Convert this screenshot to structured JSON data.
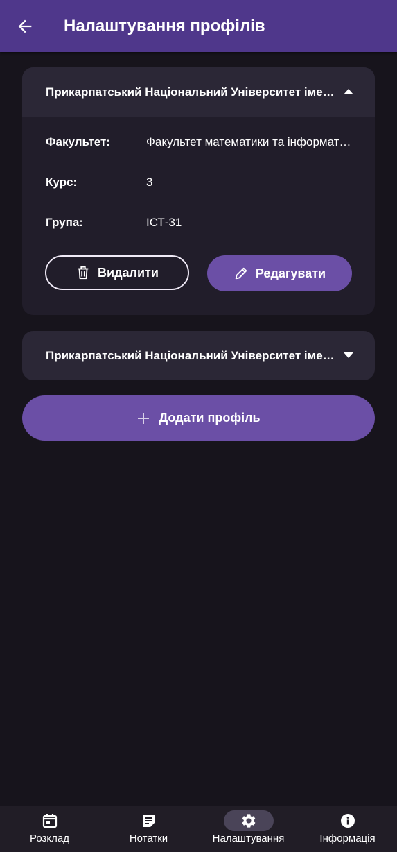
{
  "app_bar": {
    "title": "Налаштування профілів"
  },
  "profiles": [
    {
      "name": "Прикарпатський Національний Університет імені Василя Стефаника",
      "expanded": true,
      "fields": [
        {
          "label": "Факультет:",
          "value": "Факультет математики та інформатики"
        },
        {
          "label": "Курс:",
          "value": "3"
        },
        {
          "label": "Група:",
          "value": "ІСТ-31"
        }
      ],
      "delete_label": "Видалити",
      "edit_label": "Редагувати"
    },
    {
      "name": "Прикарпатський Національний Університет імені Василя Стефаника",
      "expanded": false
    }
  ],
  "add_profile_label": "Додати профіль",
  "bottom_nav": [
    {
      "label": "Розклад",
      "icon": "calendar-icon",
      "active": false
    },
    {
      "label": "Нотатки",
      "icon": "notes-icon",
      "active": false
    },
    {
      "label": "Налаштування",
      "icon": "gear-icon",
      "active": true
    },
    {
      "label": "Інформація",
      "icon": "info-icon",
      "active": false
    }
  ],
  "colors": {
    "app_bar": "#4f378b",
    "background": "#17141c",
    "card": "#211d2a",
    "card_header": "#2b2736",
    "primary_button": "#6b4fa6",
    "nav_active_pill": "#4a4458"
  }
}
